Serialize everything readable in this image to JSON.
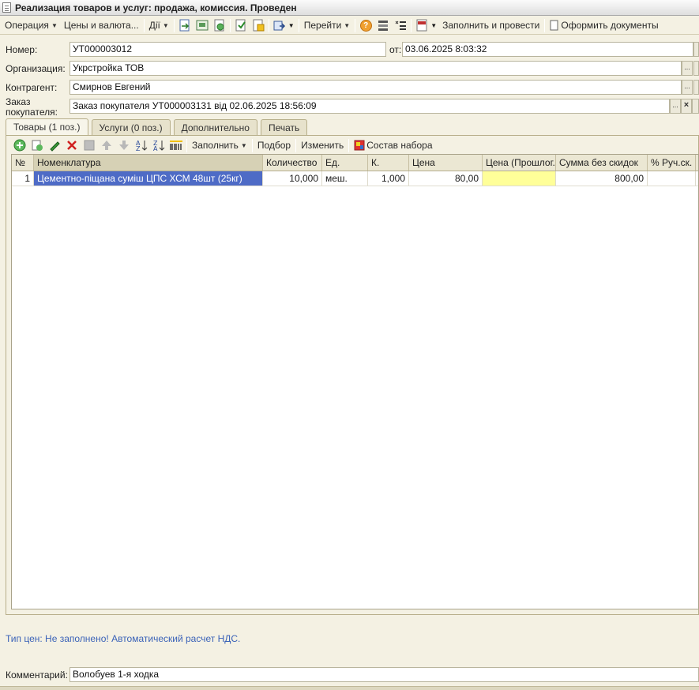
{
  "window": {
    "title": "Реализация товаров и услуг: продажа, комиссия. Проведен"
  },
  "toolbar": {
    "operation": "Операция",
    "prices": "Цены и валюта...",
    "actions": "Дії",
    "goto": "Перейти",
    "fill_and_post": "Заполнить и провести",
    "make_documents": "Оформить документы"
  },
  "form": {
    "number_label": "Номер:",
    "number_value": "УТ000003012",
    "date_label": "от:",
    "date_value": "03.06.2025  8:03:32",
    "org_label": "Организация:",
    "org_value": "Укрстройка ТОВ",
    "contractor_label": "Контрагент:",
    "contractor_value": "Смирнов Евгений",
    "order_label_1": "Заказ",
    "order_label_2": "покупателя:",
    "order_value": "Заказ покупателя УТ000003131 від 02.06.2025 18:56:09"
  },
  "tabs": [
    {
      "label": "Товары (1 поз.)",
      "active": true
    },
    {
      "label": "Услуги (0 поз.)",
      "active": false
    },
    {
      "label": "Дополнительно",
      "active": false
    },
    {
      "label": "Печать",
      "active": false
    }
  ],
  "items_toolbar": {
    "fill": "Заполнить",
    "pick": "Подбор",
    "change": "Изменить",
    "set_content": "Состав набора"
  },
  "table": {
    "columns": [
      "№",
      "Номенклатура",
      "Количество",
      "Ед.",
      "К.",
      "Цена",
      "Цена (Прошлог...",
      "Сумма без скидок",
      "% Руч.ск."
    ],
    "rows": [
      [
        "1",
        "Цементно-піщана суміш ЦПС ХСМ 48шт (25кг)",
        "10,000",
        "меш.",
        "1,000",
        "80,00",
        "",
        "800,00",
        ""
      ]
    ]
  },
  "footer": {
    "price_type_info": "Тип цен: Не заполнено! Автоматический расчет НДС.",
    "comment_label": "Комментарий:",
    "comment_value": "Волобуев 1-я ходка"
  },
  "colors": {
    "selection": "#4e6bc6",
    "highlight_cell": "#ffff99",
    "info_link": "#3a62b8"
  }
}
